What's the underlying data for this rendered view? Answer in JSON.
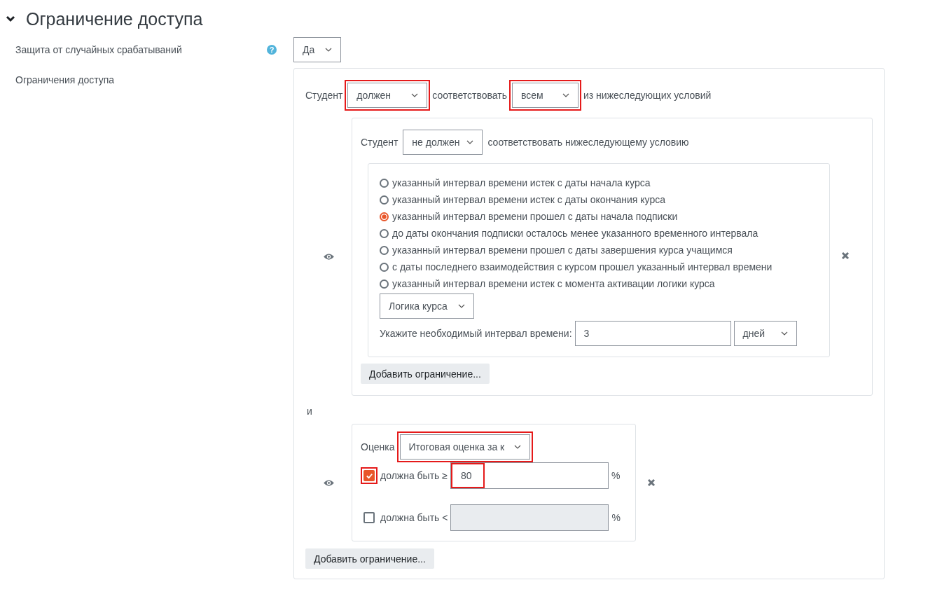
{
  "section": {
    "title": "Ограничение доступа",
    "expanded": true
  },
  "protection": {
    "label": "Защита от случайных срабатываний",
    "help": "?",
    "value": "Да"
  },
  "restrictions": {
    "label": "Ограничения доступа",
    "prefix": "Студент",
    "must": {
      "value": "должен",
      "highlighted": true
    },
    "middle": "соответствовать",
    "match": {
      "value": "всем",
      "highlighted": true
    },
    "suffix": "из нижеследующих условий",
    "conditions": [
      {
        "kind": "group",
        "prefix": "Студент",
        "must": {
          "value": "не должен",
          "highlighted": false
        },
        "suffix": "соответствовать нижеследующему условию",
        "options": [
          {
            "label": "указанный интервал времени истек с даты начала курса",
            "selected": false
          },
          {
            "label": "указанный интервал времени истек с даты окончания курса",
            "selected": false
          },
          {
            "label": "указанный интервал времени прошел с даты начала подписки",
            "selected": true
          },
          {
            "label": "до даты окончания подписки осталось менее указанного временного интервала",
            "selected": false
          },
          {
            "label": "указанный интервал времени прошел с даты завершения курса учащимся",
            "selected": false
          },
          {
            "label": "с даты последнего взаимодействия с курсом прошел указанный интервал времени",
            "selected": false
          },
          {
            "label": "указанный интервал времени истек с момента активации логики курса",
            "selected": false
          }
        ],
        "logic": "Логика курса",
        "interval_label": "Укажите необходимый интервал времени:",
        "interval_value": "3",
        "unit": "дней",
        "add_button": "Добавить ограничение..."
      },
      {
        "kind": "connector",
        "label": "и"
      },
      {
        "kind": "grade",
        "label": "Оценка",
        "grade": {
          "value": "Итоговая оценка за к",
          "highlighted": true
        },
        "min": {
          "checked": true,
          "highlighted": true,
          "label": "должна быть ≥",
          "value": "80",
          "value_highlighted": true,
          "unit": "%"
        },
        "max": {
          "checked": false,
          "label": "должна быть <",
          "unit": "%"
        }
      }
    ],
    "add_button": "Добавить ограничение..."
  }
}
